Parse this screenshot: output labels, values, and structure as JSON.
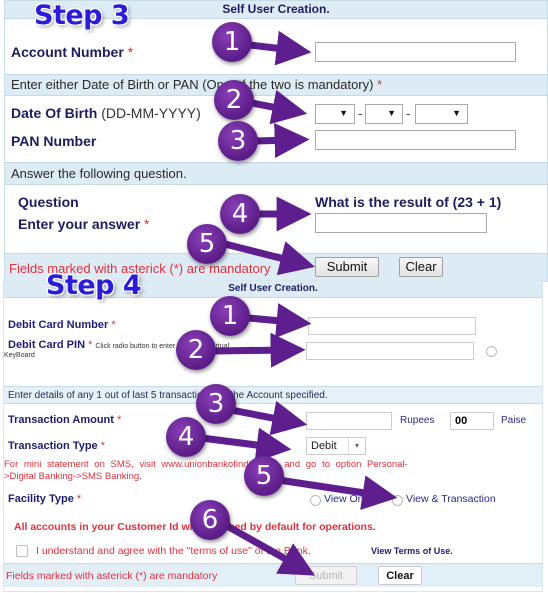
{
  "step3": {
    "step_label": "Step 3",
    "header_title": "Self User Creation.",
    "account_number": {
      "label": "Account Number",
      "required": "*",
      "value": ""
    },
    "dob_pan_instruction": "Enter either Date of Birth or PAN (One of the two is mandatory)",
    "dob_pan_required": "*",
    "date_of_birth": {
      "label": "Date Of Birth",
      "format_hint": "(DD-MM-YYYY)",
      "separator": "-",
      "day": "",
      "month": "",
      "year": ""
    },
    "pan_number": {
      "label": "PAN Number",
      "value": ""
    },
    "question_section_title": "Answer the following question.",
    "question": {
      "label": "Question",
      "text": "What is the result of (23 + 1)"
    },
    "answer": {
      "label": "Enter your answer",
      "required": "*",
      "value": ""
    },
    "mandatory_note": "Fields marked with asterick (*) are mandatory",
    "submit_label": "Submit",
    "clear_label": "Clear",
    "markers": [
      "1",
      "2",
      "3",
      "4",
      "5"
    ]
  },
  "step4": {
    "step_label": "Step 4",
    "header_title": "Self User Creation.",
    "debit_card_number": {
      "label": "Debit Card Number",
      "required": "*",
      "value": ""
    },
    "debit_card_pin": {
      "label": "Debit Card PIN",
      "required": "*",
      "hint": "Click radio button to enter PIN using Virtual",
      "hint_cont": "KeyBoard",
      "value": ""
    },
    "transactions_instruction": "Enter details of any 1 out of last 5 transactions for the Account specified.",
    "transaction_amount": {
      "label": "Transaction Amount",
      "required": "*",
      "rupees_value": "",
      "rupees_label": "Rupees",
      "paise_value": "00",
      "paise_label": "Paise"
    },
    "transaction_type": {
      "label": "Transaction Type",
      "required": "*",
      "selected": "Debit"
    },
    "sms_note_line1": "For mini statement on SMS, visit www.unionbankofindia.co.in and go to option Personal-",
    "sms_note_line2": ">Digital Banking->SMS Banking.",
    "facility_type": {
      "label": "Facility Type",
      "required": "*",
      "options": [
        "View Only",
        "View & Transaction"
      ]
    },
    "accounts_note": "All accounts in your Customer Id will be linked by default for operations.",
    "terms_text": "I understand and agree with the \"terms of use\" of the Bank.",
    "terms_link": "View Terms of Use.",
    "mandatory_note": "Fields marked with asterick (*) are mandatory",
    "submit_label": "Submit",
    "clear_label": "Clear",
    "markers": [
      "1",
      "2",
      "3",
      "4",
      "5",
      "6"
    ]
  }
}
